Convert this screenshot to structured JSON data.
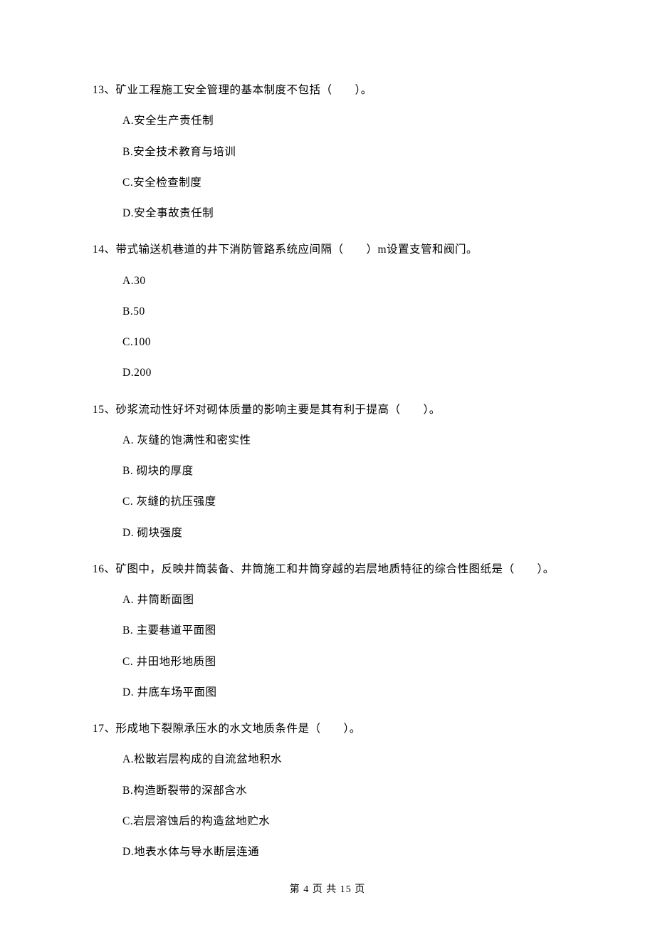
{
  "questions": [
    {
      "text": "13、矿业工程施工安全管理的基本制度不包括（　　）。",
      "options": [
        "A.安全生产责任制",
        "B.安全技术教育与培训",
        "C.安全检查制度",
        "D.安全事故责任制"
      ]
    },
    {
      "text": "14、带式输送机巷道的井下消防管路系统应间隔（　　）m设置支管和阀门。",
      "options": [
        "A.30",
        "B.50",
        "C.100",
        "D.200"
      ]
    },
    {
      "text": "15、砂浆流动性好坏对砌体质量的影响主要是其有利于提高（　　）。",
      "options": [
        "A. 灰缝的饱满性和密实性",
        "B. 砌块的厚度",
        "C. 灰缝的抗压强度",
        "D. 砌块强度"
      ]
    },
    {
      "text": "16、矿图中，反映井筒装备、井筒施工和井筒穿越的岩层地质特征的综合性图纸是（　　）。",
      "options": [
        "A. 井筒断面图",
        "B. 主要巷道平面图",
        "C. 井田地形地质图",
        "D. 井底车场平面图"
      ]
    },
    {
      "text": "17、形成地下裂隙承压水的水文地质条件是（　　）。",
      "options": [
        "A.松散岩层构成的自流盆地积水",
        "B.构造断裂带的深部含水",
        "C.岩层溶蚀后的构造盆地贮水",
        "D.地表水体与导水断层连通"
      ]
    }
  ],
  "footer": "第 4 页 共 15 页"
}
